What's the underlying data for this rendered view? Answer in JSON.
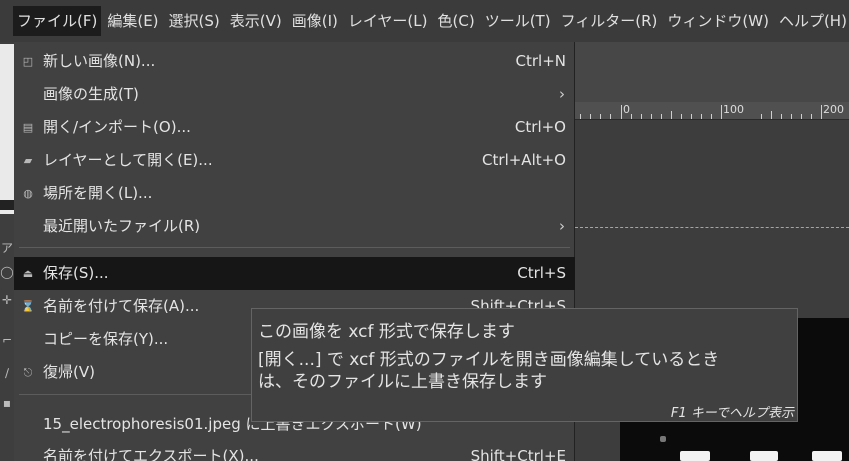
{
  "menubar": {
    "items": [
      {
        "label": "ファイル(F)"
      },
      {
        "label": "編集(E)"
      },
      {
        "label": "選択(S)"
      },
      {
        "label": "表示(V)"
      },
      {
        "label": "画像(I)"
      },
      {
        "label": "レイヤー(L)"
      },
      {
        "label": "色(C)"
      },
      {
        "label": "ツール(T)"
      },
      {
        "label": "フィルター(R)"
      },
      {
        "label": "ウィンドウ(W)"
      },
      {
        "label": "ヘルプ(H)"
      }
    ]
  },
  "file_menu": {
    "items": [
      {
        "icon": "new-image-icon",
        "label": "新しい画像(N)...",
        "shortcut": "Ctrl+N"
      },
      {
        "icon": "",
        "label": "画像の生成(T)",
        "submenu": true
      },
      {
        "icon": "open-icon",
        "label": "開く/インポート(O)...",
        "shortcut": "Ctrl+O"
      },
      {
        "icon": "open-as-layers-icon",
        "label": "レイヤーとして開く(E)...",
        "shortcut": "Ctrl+Alt+O"
      },
      {
        "icon": "open-location-icon",
        "label": "場所を開く(L)..."
      },
      {
        "icon": "",
        "label": "最近開いたファイル(R)",
        "submenu": true
      },
      {
        "icon": "save-icon",
        "label": "保存(S)...",
        "shortcut": "Ctrl+S",
        "highlighted": true
      },
      {
        "icon": "save-as-icon",
        "label": "名前を付けて保存(A)...",
        "shortcut": "Shift+Ctrl+S"
      },
      {
        "icon": "",
        "label": "コピーを保存(Y)..."
      },
      {
        "icon": "revert-icon",
        "label": "復帰(V)"
      },
      {
        "icon": "",
        "label": "15_electrophoresis01.jpeg に上書きエクスポート(W)"
      },
      {
        "icon": "",
        "label": "名前を付けてエクスポート(X)...",
        "shortcut": "Shift+Ctrl+E"
      }
    ]
  },
  "tooltip": {
    "line1": "この画像を xcf 形式で保存します",
    "line2": "[開く...] で xcf 形式のファイルを開き画像編集しているとき",
    "line3": "は、そのファイルに上書き保存します",
    "help": "F1 キーでヘルプ表示"
  },
  "ruler": {
    "labels": [
      "0",
      "100",
      "200"
    ]
  }
}
